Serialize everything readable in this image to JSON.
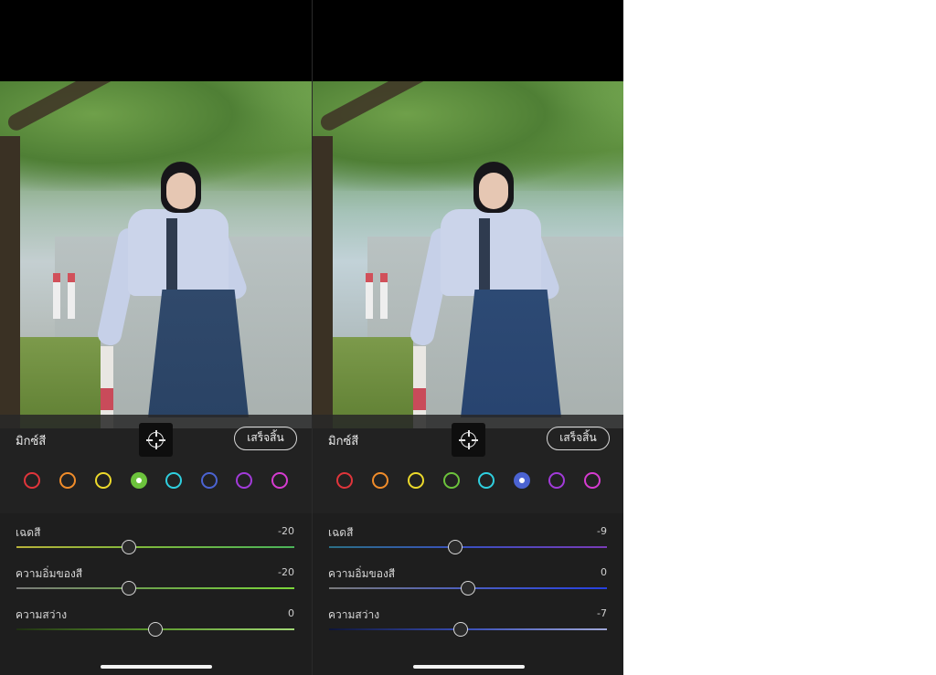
{
  "panels": [
    {
      "title": "มิกซ์สี",
      "done_label": "เสร็จสิ้น",
      "swatches": [
        {
          "name": "red",
          "color": "#e0353b",
          "selected": false
        },
        {
          "name": "orange",
          "color": "#f08c2a",
          "selected": false
        },
        {
          "name": "yellow",
          "color": "#ecd92b",
          "selected": false
        },
        {
          "name": "green",
          "color": "#6cc33c",
          "selected": true
        },
        {
          "name": "aqua",
          "color": "#2fcfdf",
          "selected": false
        },
        {
          "name": "blue",
          "color": "#4b63d2",
          "selected": false
        },
        {
          "name": "purple",
          "color": "#a23bd9",
          "selected": false
        },
        {
          "name": "magenta",
          "color": "#d63bd0",
          "selected": false
        }
      ],
      "sliders": [
        {
          "label": "เฉดสี",
          "value": "-20",
          "fraction": 0.405,
          "gradient": "linear-gradient(90deg, #b8b23a, #7fb83b 45%, #4bb45a)"
        },
        {
          "label": "ความอิ่มของสี",
          "value": "-20",
          "fraction": 0.405,
          "gradient": "linear-gradient(90deg, #7a7a7a, #6ea84a 50%, #7bd63a)"
        },
        {
          "label": "ความสว่าง",
          "value": "0",
          "fraction": 0.5,
          "gradient": "linear-gradient(90deg, #1f3012, #5d9b2e 50%, #a2d876)"
        }
      ]
    },
    {
      "title": "มิกซ์สี",
      "done_label": "เสร็จสิ้น",
      "swatches": [
        {
          "name": "red",
          "color": "#e0353b",
          "selected": false
        },
        {
          "name": "orange",
          "color": "#f08c2a",
          "selected": false
        },
        {
          "name": "yellow",
          "color": "#ecd92b",
          "selected": false
        },
        {
          "name": "green",
          "color": "#6cc33c",
          "selected": false
        },
        {
          "name": "aqua",
          "color": "#2fcfdf",
          "selected": false
        },
        {
          "name": "blue",
          "color": "#4b63d2",
          "selected": true
        },
        {
          "name": "purple",
          "color": "#a23bd9",
          "selected": false
        },
        {
          "name": "magenta",
          "color": "#d63bd0",
          "selected": false
        }
      ],
      "sliders": [
        {
          "label": "เฉดสี",
          "value": "-9",
          "fraction": 0.455,
          "gradient": "linear-gradient(90deg, #2b6f86, #3a4fc0 50%, #7a3bb8)"
        },
        {
          "label": "ความอิ่มของสี",
          "value": "0",
          "fraction": 0.5,
          "gradient": "linear-gradient(90deg, #7a7a7a, #4b5ec0 50%, #2640e0)"
        },
        {
          "label": "ความสว่าง",
          "value": "-7",
          "fraction": 0.475,
          "gradient": "linear-gradient(90deg, #0e1538, #3a4fb8 50%, #a0a8d8)"
        }
      ]
    }
  ]
}
